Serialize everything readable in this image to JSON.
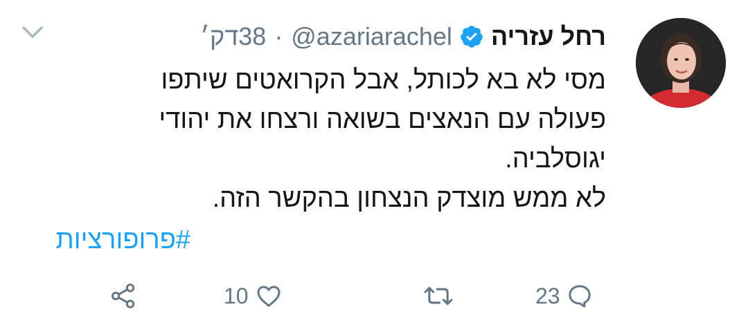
{
  "author": {
    "name": "רחל עזריה",
    "handle": "@azariarachel",
    "separator": "·",
    "time": "38דק׳",
    "verified": true,
    "verified_color": "#1da1f2"
  },
  "tweet": {
    "lines": [
      "מסי לא בא לכותל, אבל הקרואטים שיתפו",
      "פעולה עם הנאצים בשואה ורצחו את יהודי",
      "יגוסלביה.",
      "לא ממש מוצדק הנצחון בהקשר הזה."
    ],
    "hashtag": "#פרופורציות"
  },
  "actions": {
    "reply_count": "23",
    "retweet_count": "",
    "like_count": "10",
    "share_count": ""
  },
  "icons": {
    "reply": "reply-icon",
    "retweet": "retweet-icon",
    "like": "heart-icon",
    "share": "share-icon",
    "menu": "chevron-down-icon",
    "verified": "verified-badge-icon"
  },
  "colors": {
    "text": "#14171a",
    "secondary": "#657786",
    "accent": "#1da1f2",
    "background": "#ffffff"
  }
}
